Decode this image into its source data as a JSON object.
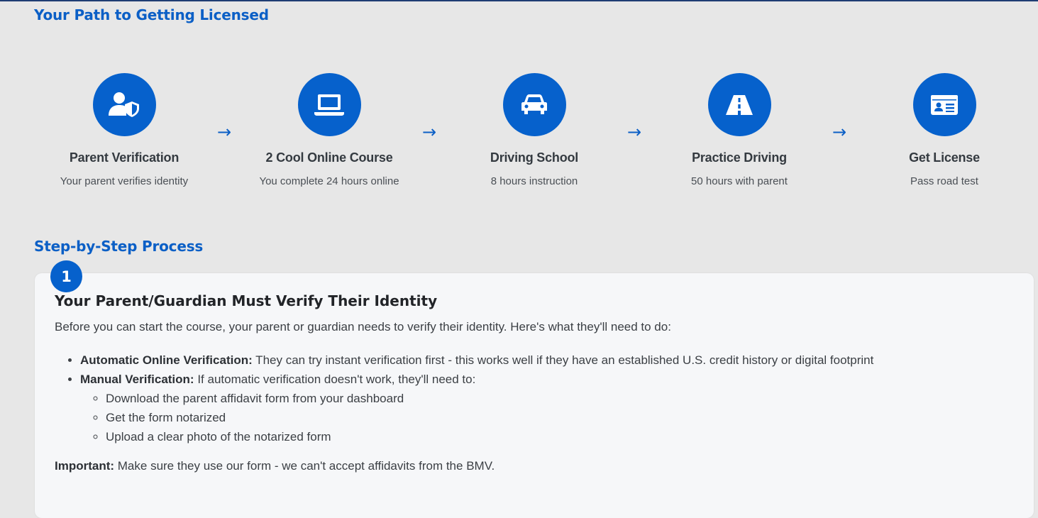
{
  "path": {
    "title": "Your Path to Getting Licensed",
    "arrow_glyph": "→",
    "steps": [
      {
        "label": "Parent Verification",
        "desc": "Your parent verifies identity",
        "icon": "user-shield-icon"
      },
      {
        "label": "2 Cool Online Course",
        "desc": "You complete 24 hours online",
        "icon": "laptop-icon"
      },
      {
        "label": "Driving School",
        "desc": "8 hours instruction",
        "icon": "car-icon"
      },
      {
        "label": "Practice Driving",
        "desc": "50 hours with parent",
        "icon": "road-icon"
      },
      {
        "label": "Get License",
        "desc": "Pass road test",
        "icon": "id-card-icon"
      }
    ]
  },
  "process": {
    "title": "Step-by-Step Process",
    "card": {
      "number": "1",
      "title": "Your Parent/Guardian Must Verify Their Identity",
      "intro": "Before you can start the course, your parent or guardian needs to verify their identity. Here's what they'll need to do:",
      "items": [
        {
          "label": "Automatic Online Verification:",
          "text": " They can try instant verification first - this works well if they have an established U.S. credit history or digital footprint"
        },
        {
          "label": "Manual Verification:",
          "text": " If automatic verification doesn't work, they'll need to:"
        }
      ],
      "subitems": [
        "Download the parent affidavit form from your dashboard",
        "Get the form notarized",
        "Upload a clear photo of the notarized form"
      ],
      "important_label": "Important:",
      "important_text": " Make sure they use our form - we can't accept affidavits from the BMV."
    }
  },
  "colors": {
    "accent": "#0661cc",
    "heading": "#0b5fc6",
    "background": "#e7e7e7",
    "card": "#f6f7f9"
  }
}
